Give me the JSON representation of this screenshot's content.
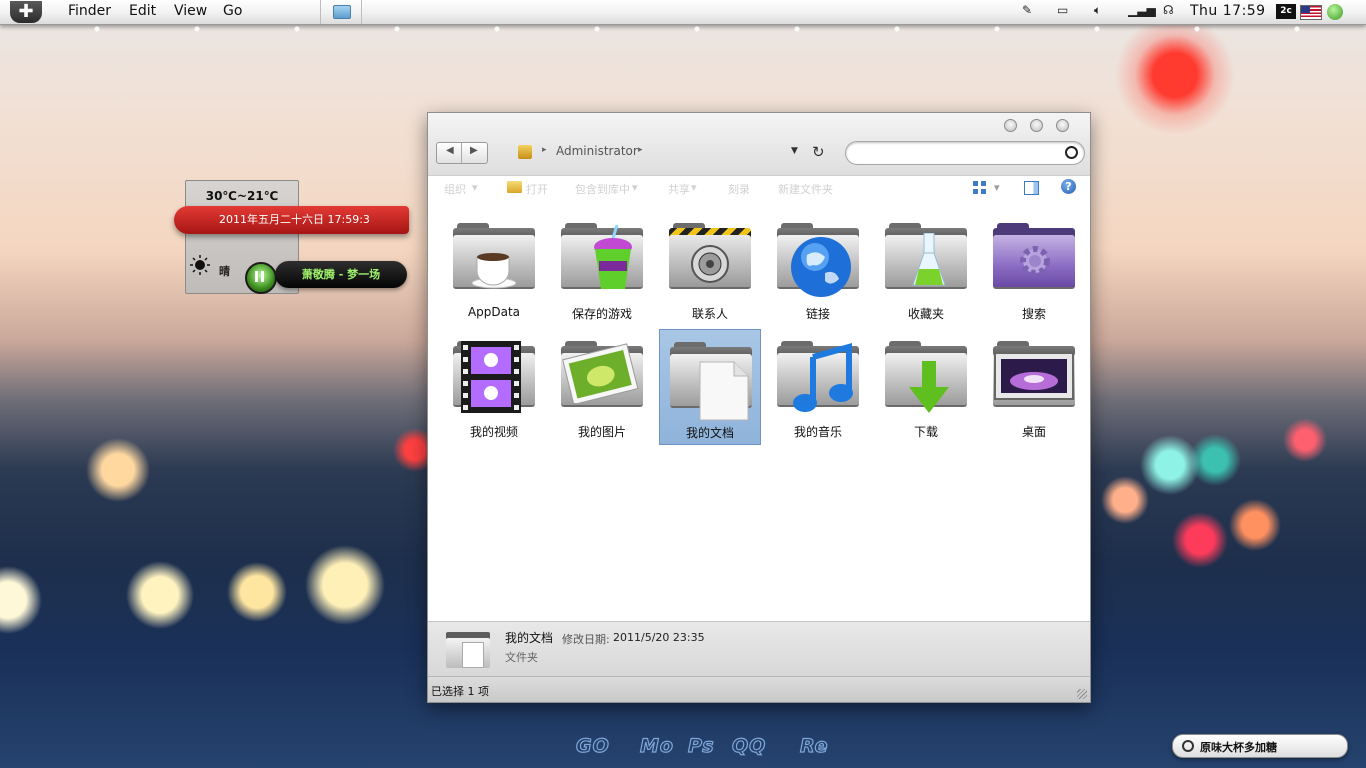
{
  "menubar": {
    "menus": [
      "Finder",
      "Edit",
      "View",
      "Go"
    ],
    "clock": "Thu 17:59",
    "input_method": "2c"
  },
  "widget": {
    "temp_range": "30℃~21℃",
    "datetime": "2011年五月二十六日 17:59:3",
    "weather": "晴",
    "song": "萧敬腾 - 梦一场"
  },
  "window": {
    "breadcrumb": "Administrator",
    "search_placeholder": "",
    "toolbar": {
      "organize": "组织",
      "open": "打开",
      "include_in_library": "包含到库中",
      "share": "共享",
      "burn": "刻录",
      "new_folder": "新建文件夹"
    },
    "items": [
      {
        "label": "AppData"
      },
      {
        "label": "保存的游戏"
      },
      {
        "label": "联系人"
      },
      {
        "label": "链接"
      },
      {
        "label": "收藏夹"
      },
      {
        "label": "搜索"
      },
      {
        "label": "我的视频"
      },
      {
        "label": "我的图片"
      },
      {
        "label": "我的文档"
      },
      {
        "label": "我的音乐"
      },
      {
        "label": "下载"
      },
      {
        "label": "桌面"
      }
    ],
    "details": {
      "name": "我的文档",
      "modified_label": "修改日期:",
      "modified_value": "2011/5/20 23:35",
      "type": "文件夹"
    },
    "status": "已选择 1 项"
  },
  "dock": [
    "GO",
    "Mo",
    "Ps",
    "QQ",
    "Re"
  ],
  "spotlight": {
    "value": "原味大杯多加糖"
  },
  "colors": {
    "selection": "#a9c6e6",
    "date_bar": "#c62a26",
    "song_text": "#9ff36c"
  }
}
